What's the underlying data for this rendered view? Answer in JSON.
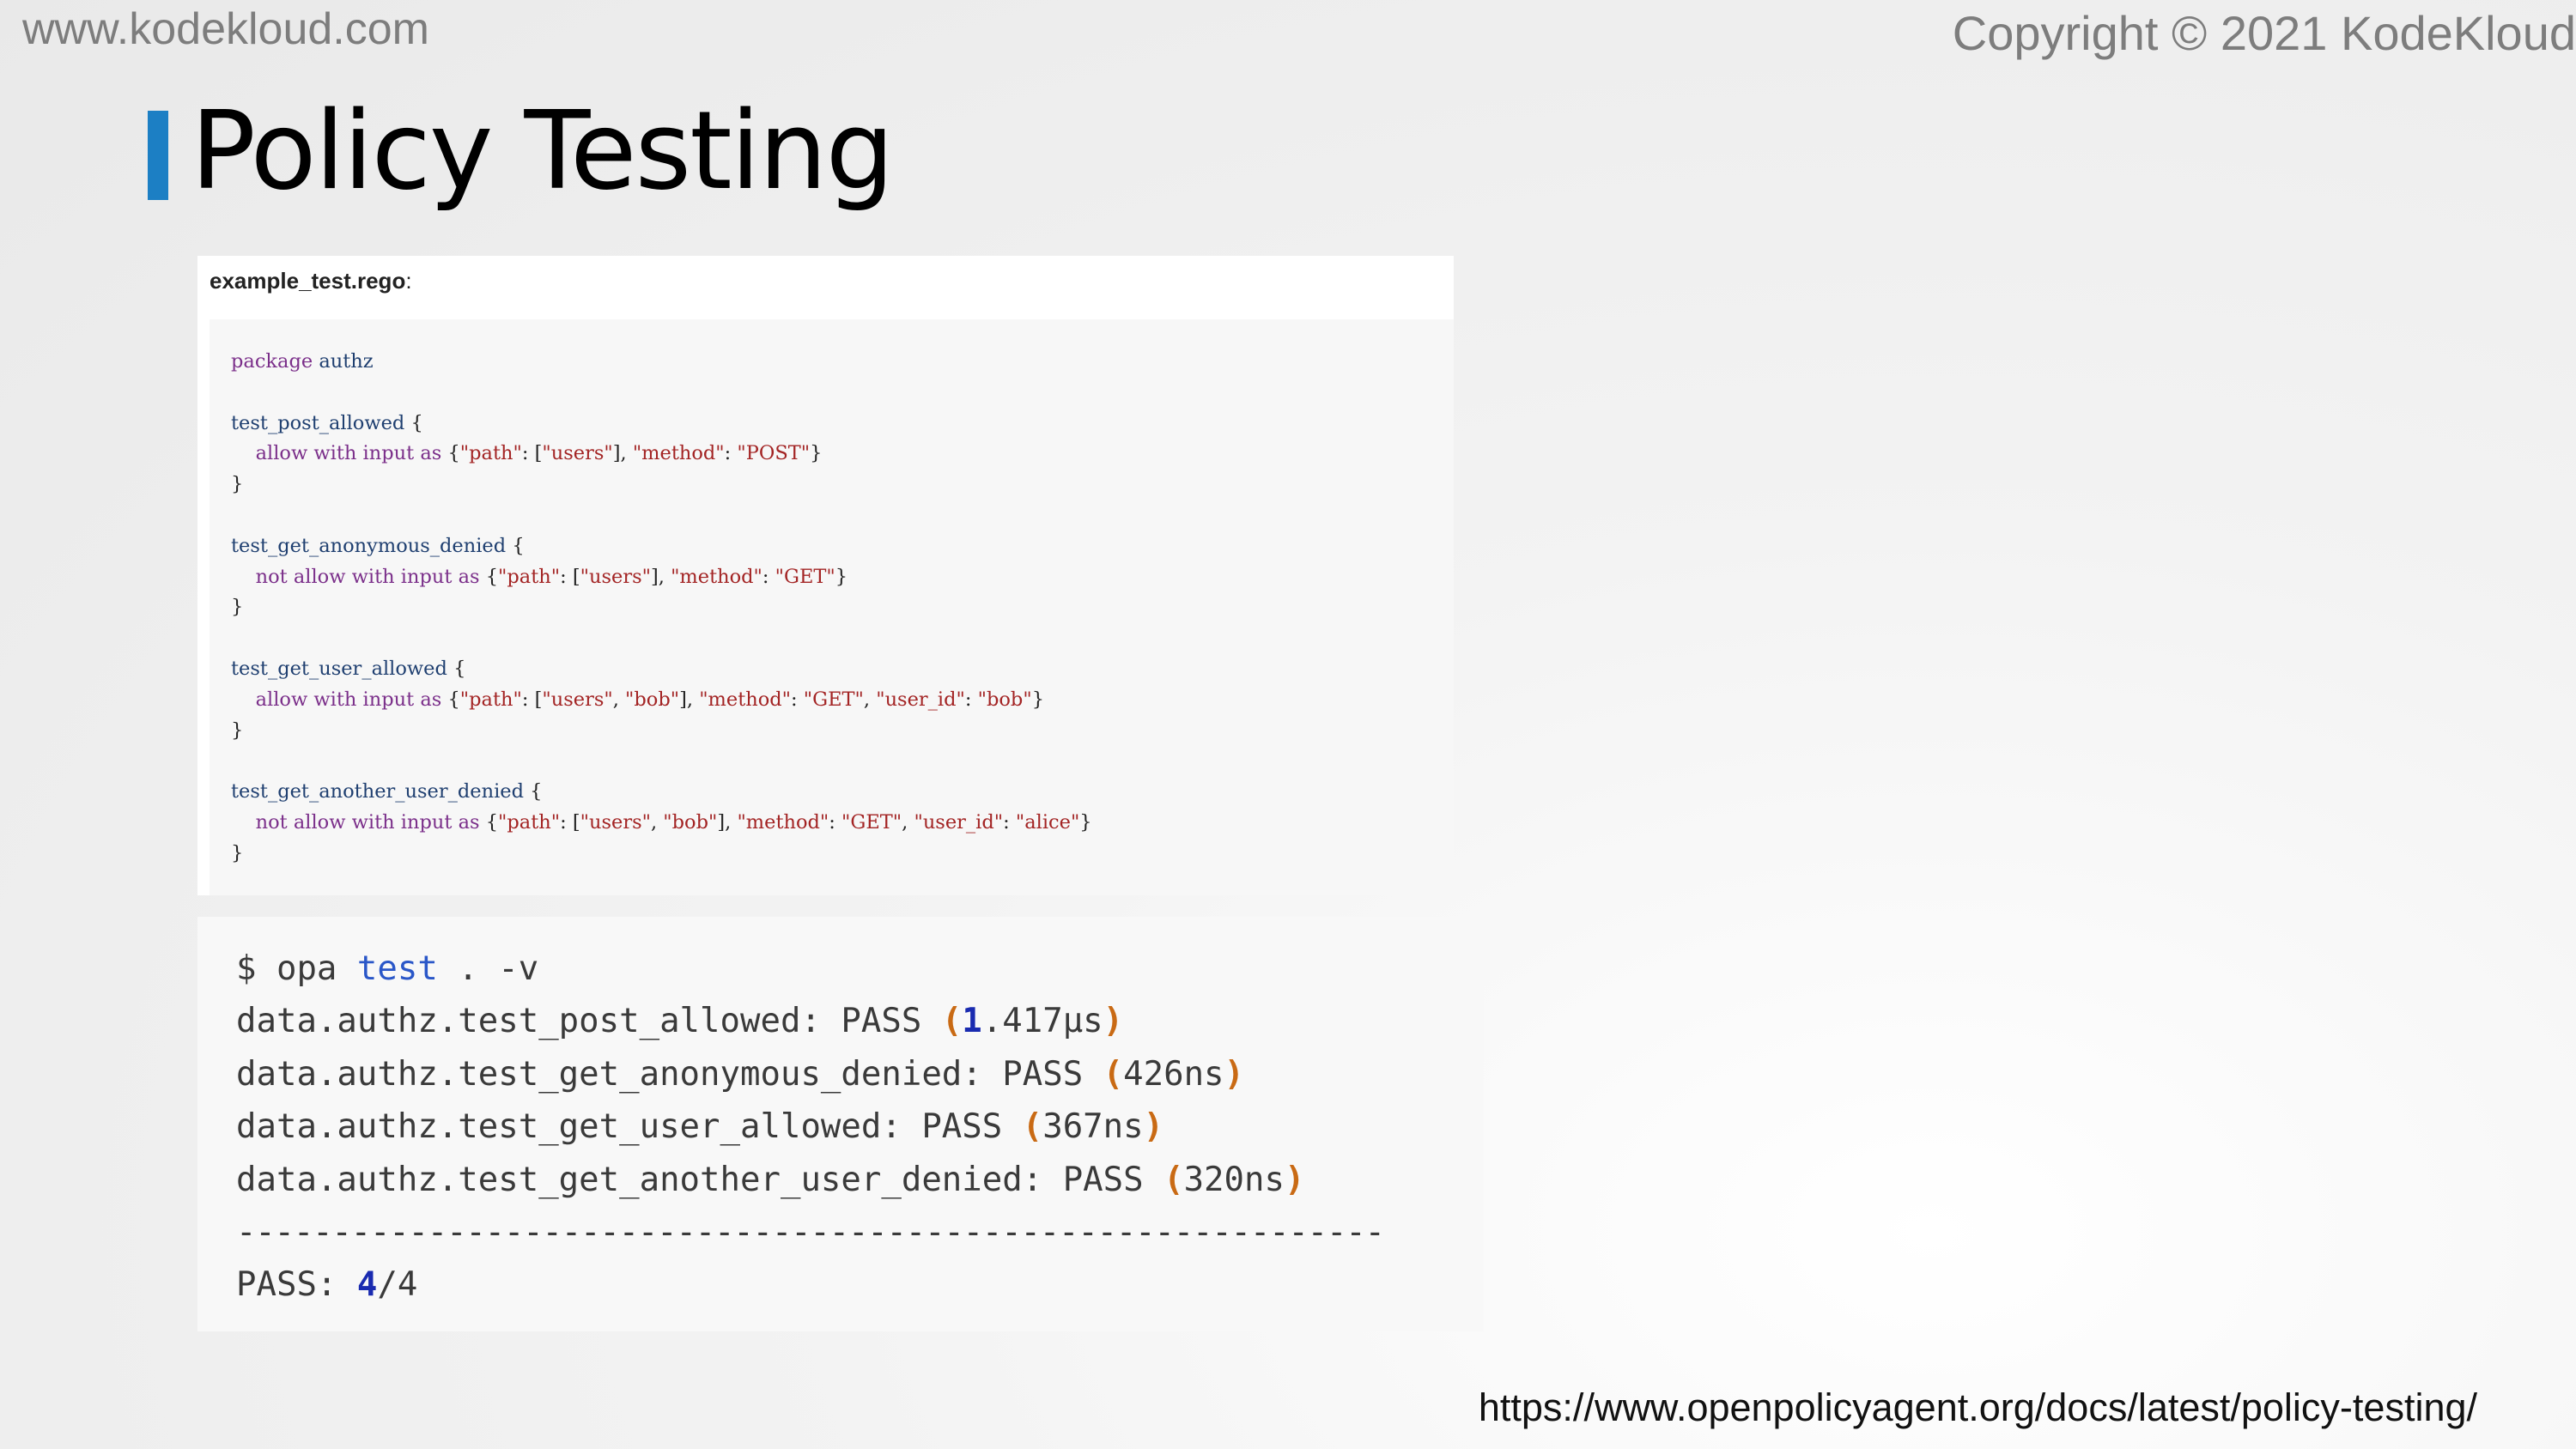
{
  "header": {
    "site_url": "www.kodekloud.com",
    "copyright": "Copyright © 2021 KodeKloud"
  },
  "slide": {
    "title": "Policy Testing",
    "accent_color": "#1c7fc4"
  },
  "code_panel": {
    "filename": "example_test.rego",
    "filename_suffix": ":",
    "lines": [
      "package authz",
      "",
      "test_post_allowed {",
      "    allow with input as {\"path\": [\"users\"], \"method\": \"POST\"}",
      "}",
      "",
      "test_get_anonymous_denied {",
      "    not allow with input as {\"path\": [\"users\"], \"method\": \"GET\"}",
      "}",
      "",
      "test_get_user_allowed {",
      "    allow with input as {\"path\": [\"users\", \"bob\"], \"method\": \"GET\", \"user_id\": \"bob\"}",
      "}",
      "",
      "test_get_another_user_denied {",
      "    not allow with input as {\"path\": [\"users\", \"bob\"], \"method\": \"GET\", \"user_id\": \"alice\"}",
      "}"
    ]
  },
  "terminal": {
    "command": "$ opa test . -v",
    "results": [
      {
        "name": "data.authz.test_post_allowed:",
        "status": "PASS",
        "time": "(1.417µs)"
      },
      {
        "name": "data.authz.test_get_anonymous_denied:",
        "status": "PASS",
        "time": "(426ns)"
      },
      {
        "name": "data.authz.test_get_user_allowed:",
        "status": "PASS",
        "time": "(367ns)"
      },
      {
        "name": "data.authz.test_get_another_user_denied:",
        "status": "PASS",
        "time": "(320ns)"
      }
    ],
    "separator": "------------------------------------------------------------",
    "summary": "PASS: 4/4"
  },
  "footer": {
    "source_url": "https://www.openpolicyagent.org/docs/latest/policy-testing/"
  }
}
